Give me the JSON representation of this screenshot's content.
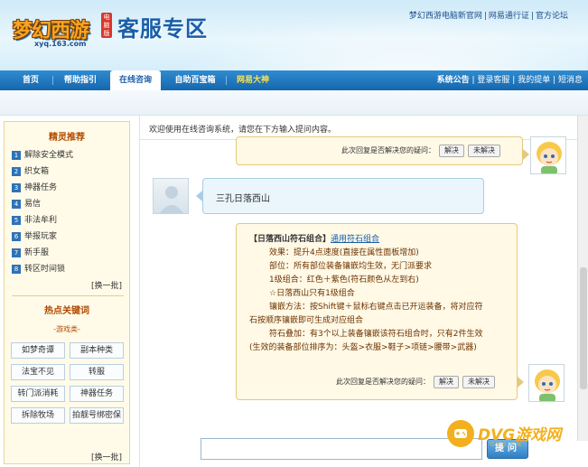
{
  "header": {
    "logo_text": "梦幻西游",
    "logo_badge": "电脑版",
    "logo_domain": "xyq.163.com",
    "site_title": "客服专区",
    "top_links": [
      "梦幻西游电脑新官网",
      "网易通行证",
      "官方论坛"
    ]
  },
  "nav": {
    "items": [
      "首页",
      "帮助指引",
      "在线咨询",
      "自助百宝箱",
      "网易大神"
    ],
    "right_links": [
      "系统公告",
      "登录客服",
      "我的提单",
      "短消息"
    ]
  },
  "sidebar": {
    "title": "精灵推荐",
    "items": [
      {
        "num": "1",
        "label": "解除安全模式"
      },
      {
        "num": "2",
        "label": "织女箱"
      },
      {
        "num": "3",
        "label": "神器任务"
      },
      {
        "num": "4",
        "label": "易信"
      },
      {
        "num": "5",
        "label": "非法牟利"
      },
      {
        "num": "6",
        "label": "举报玩家"
      },
      {
        "num": "7",
        "label": "新手服"
      },
      {
        "num": "8",
        "label": "转区时间锁"
      }
    ],
    "more": "[换一批]",
    "hot_title": "热点关键词",
    "hot_sub": "-游戏类-",
    "keywords": [
      "如梦奇谭",
      "副本种类",
      "法宝不见",
      "转服",
      "转门派消耗",
      "神器任务",
      "拆除牧场",
      "拍靓号绑密保"
    ],
    "more2": "[换一批]"
  },
  "main": {
    "welcome": "欢迎使用在线咨询系统，请您在下方输入提问内容。",
    "feedback_question": "此次回复是否解决您的疑问：",
    "btn_solved": "解决",
    "btn_unsolved": "未解决",
    "user_message": "三孔日落西山",
    "answer": {
      "title": "【日落西山符石组合】",
      "link": "通用符石组合",
      "lines": [
        "效果：提升4点速度(直接在属性面板增加)",
        "部位：所有部位装备镶嵌均生效，无门派要求",
        "1级组合：红色＋紫色(符石颜色从左到右)",
        "☆日落西山只有1级组合",
        "镶嵌方法：按Shift键＋鼠标右键点击已开运装备，将对应符"
      ],
      "line_wrap": "石按顺序镶嵌即可生成对应组合",
      "line_stack": "符石叠加：有3个以上装备镶嵌该符石组合时，只有2件生效",
      "line_stack2": "(生效的装备部位排序为：头盔>衣服>鞋子>项链>腰带>武器)"
    },
    "ask_button": "提问"
  },
  "watermark": {
    "text": "DVG游戏网",
    "sub": "DVG.CN"
  }
}
